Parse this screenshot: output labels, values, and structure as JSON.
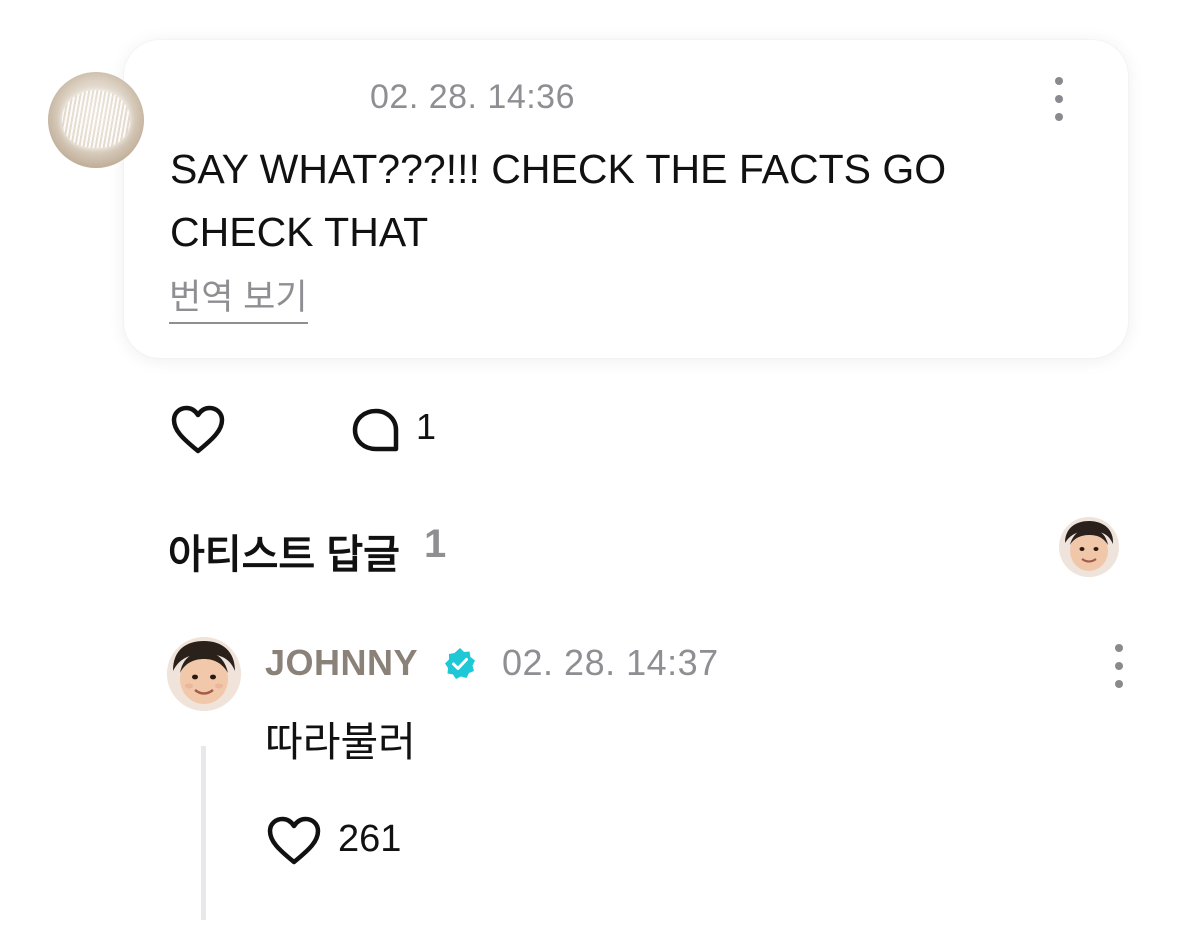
{
  "comment": {
    "timestamp": "02. 28. 14:36",
    "text": "SAY WHAT???!!! CHECK THE FACTS GO CHECK THAT",
    "translate_label": "번역 보기",
    "reply_count": "1",
    "avatar_icon": "fuzzy-white-plant-avatar"
  },
  "artist_replies": {
    "title": "아티스트 답글",
    "count": "1"
  },
  "reply": {
    "author": "JOHNNY",
    "verified_icon": "verified-badge-icon",
    "verified_color": "#1ec8d6",
    "timestamp": "02. 28. 14:37",
    "text": "따라불러",
    "like_count": "261"
  }
}
